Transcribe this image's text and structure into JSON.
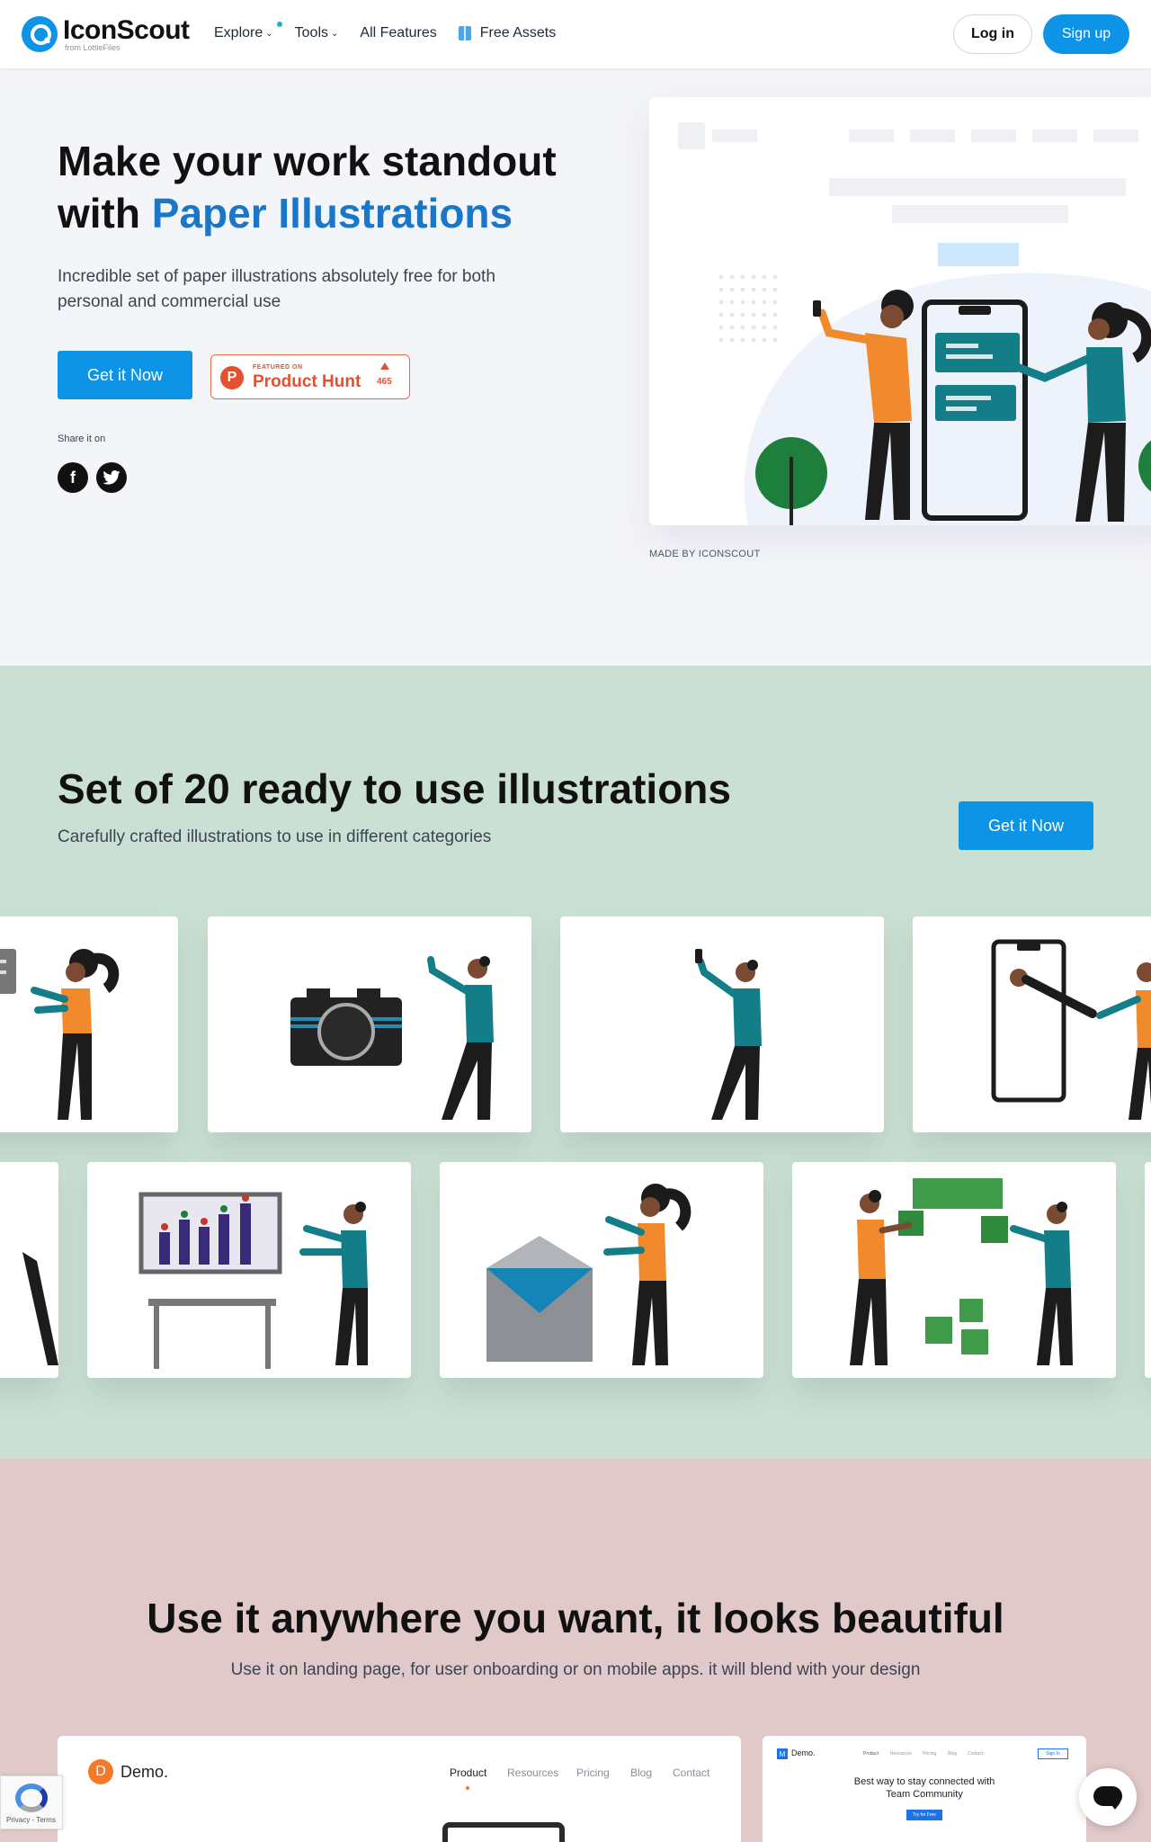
{
  "header": {
    "logo_title": "IconScout",
    "logo_sub": "from LottieFiles",
    "nav": [
      {
        "label": "Explore"
      },
      {
        "label": "Tools"
      },
      {
        "label": "All Features"
      },
      {
        "label": "Free Assets"
      }
    ],
    "login_label": "Log in",
    "signup_label": "Sign up"
  },
  "hero": {
    "title_line1": "Make your work standout",
    "title_with": "with",
    "title_accent": "Paper Illustrations",
    "description": "Incredible set of paper illustrations absolutely free for both personal and commercial use",
    "cta_label": "Get it Now",
    "product_hunt": {
      "featured": "FEATURED ON",
      "name": "Product Hunt",
      "count": "465"
    },
    "share_label": "Share it on",
    "made_by": "MADE BY ICONSCOUT"
  },
  "set": {
    "title": "Set of 20 ready to use illustrations",
    "subtitle": "Carefully crafted illustrations to use in different categories",
    "cta_label": "Get it Now"
  },
  "use": {
    "title": "Use it anywhere you want, it looks beautiful",
    "subtitle": "Use it on landing page, for user onboarding or on mobile apps. it will blend with your design",
    "demo1": {
      "logo_letter": "D",
      "name": "Demo.",
      "nav": [
        "Product",
        "Resources",
        "Pricing",
        "Blog",
        "Contact"
      ]
    },
    "demo2": {
      "logo_letter": "M",
      "name": "Demo.",
      "nav": [
        "Product",
        "Resources",
        "Pricing",
        "Blog",
        "Contact"
      ],
      "signin": "Sign In",
      "headline_line1": "Best way to stay connected with",
      "headline_line2": "Team Community",
      "cta": "Try for Free"
    }
  },
  "recaptcha_text": "Privacy - Terms",
  "colors": {
    "primary": "#0d94e6",
    "accent_text": "#1976c9",
    "hero_bg": "#f4f5f8",
    "set_bg": "#cbe0d4",
    "use_bg": "#e2c9c9",
    "orange": "#f08a2c",
    "teal": "#137e88"
  }
}
